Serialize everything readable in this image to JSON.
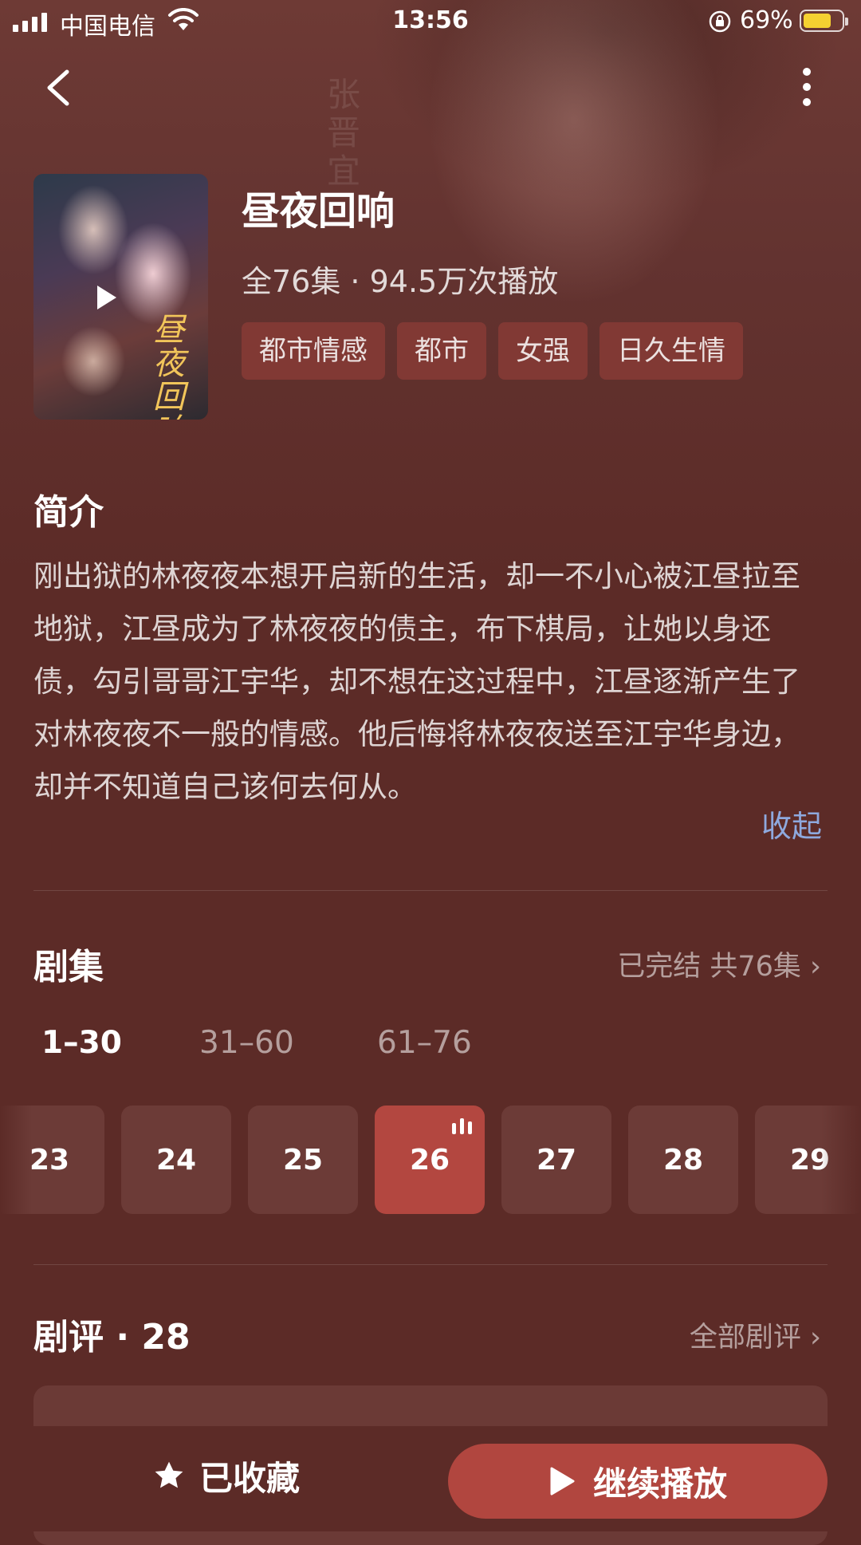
{
  "status_bar": {
    "carrier": "中国电信",
    "time": "13:56",
    "battery_percent": "69%",
    "battery_level": 0.69,
    "battery_color": "#f5d131"
  },
  "nav": {
    "back_icon": "chevron-left-icon",
    "more_icon": "more-vertical-icon"
  },
  "hero": {
    "watermark_text": "张晋宜",
    "poster_calligraphy": "昼夜回响"
  },
  "show": {
    "title": "昼夜回响",
    "meta": "全76集 · 94.5万次播放",
    "tags": [
      "都市情感",
      "都市",
      "女强",
      "日久生情"
    ]
  },
  "intro": {
    "heading": "简介",
    "text": "刚出狱的林夜夜本想开启新的生活，却一不小心被江昼拉至地狱，江昼成为了林夜夜的债主，布下棋局，让她以身还债，勾引哥哥江宇华，却不想在这过程中，江昼逐渐产生了对林夜夜不一般的情感。他后悔将林夜夜送至江宇华身边，却并不知道自己该何去何从。",
    "collapse_label": "收起"
  },
  "episodes": {
    "heading": "剧集",
    "status_link": "已完结 共76集 ›",
    "ranges": [
      "1–30",
      "31–60",
      "61–76"
    ],
    "active_range_index": 0,
    "items": [
      "23",
      "24",
      "25",
      "26",
      "27",
      "28",
      "29"
    ],
    "current_episode": "26"
  },
  "reviews": {
    "heading": "剧评 · 28",
    "all_link": "全部剧评 ›"
  },
  "bottom_bar": {
    "favorite_label": "已收藏",
    "play_label": "继续播放",
    "accent_color": "#b1463f"
  }
}
